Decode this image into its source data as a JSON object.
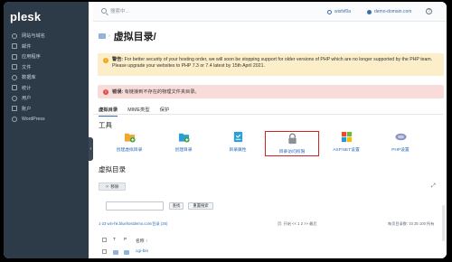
{
  "app": {
    "logo": "plesk"
  },
  "sidebar": {
    "items": [
      {
        "label": "网站与域名",
        "icon": "globe-icon"
      },
      {
        "label": "邮件",
        "icon": "mail-icon"
      },
      {
        "label": "应用程序",
        "icon": "apps-icon"
      },
      {
        "label": "文件",
        "icon": "files-icon"
      },
      {
        "label": "数据库",
        "icon": "database-icon"
      },
      {
        "label": "统计",
        "icon": "stats-icon"
      },
      {
        "label": "用户",
        "icon": "users-icon"
      },
      {
        "label": "账户",
        "icon": "account-icon"
      },
      {
        "label": "WordPress",
        "icon": "wordpress-icon"
      }
    ],
    "collapse_glyph": "‹"
  },
  "topbar": {
    "search_placeholder": "搜索中...",
    "user": "wisfsf0a",
    "domain": "demo-domain.com",
    "help": "?"
  },
  "page": {
    "crumb_sep": "›",
    "title": "虚拟目录/"
  },
  "alerts": {
    "warning_label": "警告:",
    "warning_text": "For better security of your hosting order, we will soon be stopping support for older versions of PHP which are no longer supported by the PHP team. Please upgrade your websites to PHP 7.3 or 7.4 latest by 15th April 2021.",
    "error_label": "错误:",
    "error_text": "有链接到不存在的物理文件夹目录。"
  },
  "tabs": [
    {
      "label": "虚拟目录",
      "active": true
    },
    {
      "label": "MIME类型",
      "active": false
    },
    {
      "label": "保护",
      "active": false
    }
  ],
  "tools": {
    "heading": "工具",
    "items": [
      {
        "label": "创建虚拟目录",
        "icon": "create-virtual-dir-icon"
      },
      {
        "label": "创建目录",
        "icon": "create-dir-icon"
      },
      {
        "label": "目录属性",
        "icon": "dir-properties-icon"
      },
      {
        "label": "目录访问权限",
        "icon": "lock-icon",
        "selected": true
      },
      {
        "label": "ASP.NET设置",
        "icon": "aspnet-icon"
      },
      {
        "label": "PHP设置",
        "icon": "php-icon"
      }
    ]
  },
  "listing": {
    "heading": "虚拟目录",
    "remove_button": "移除",
    "expand_glyph": "⤢",
    "filter_placeholder": "",
    "search_button": "查找",
    "reset_button": "重置搜索",
    "path": "1-23 win-hk.bluehostdemo.com/目录 (26)",
    "pager": "页: 开始 << 1 2 >> 最后",
    "per_page": "每页目录数: 10 25 100 所有",
    "columns": {
      "t": "T",
      "p": "P",
      "name": "名称 ↑"
    },
    "rows": [
      {
        "name": "cgi-bin"
      }
    ]
  },
  "colors": {
    "sidebar_bg": "#2d3a48",
    "accent": "#2b6fb8",
    "warning_bg": "#fbeec8",
    "error_bg": "#f9dcd9",
    "highlight": "#d42222"
  }
}
